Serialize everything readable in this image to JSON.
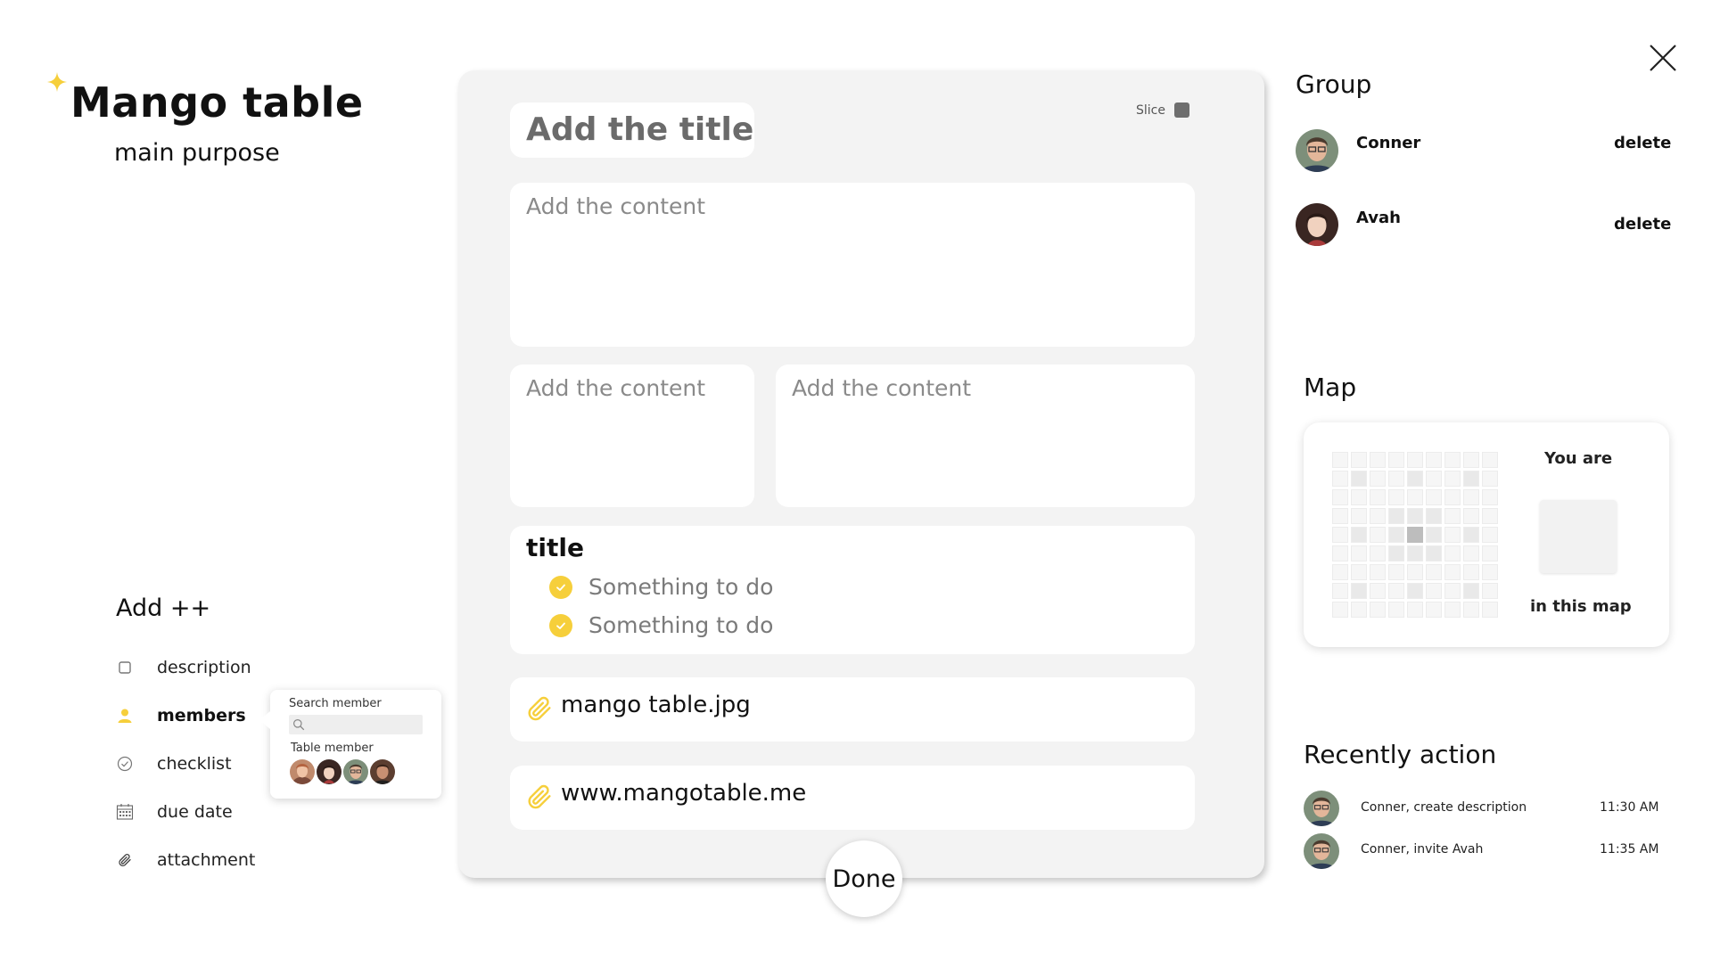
{
  "app": {
    "title": "Mango table",
    "subtitle": "main purpose",
    "accent_color": "#f6cf3b"
  },
  "add_menu": {
    "title": "Add ++",
    "items": [
      {
        "label": "description",
        "icon": "square-icon"
      },
      {
        "label": "members",
        "icon": "person-icon",
        "active": true
      },
      {
        "label": "checklist",
        "icon": "check-circle-icon"
      },
      {
        "label": "due date",
        "icon": "calendar-icon"
      },
      {
        "label": "attachment",
        "icon": "paperclip-icon"
      }
    ]
  },
  "member_popup": {
    "search_label": "Search member",
    "search_value": "",
    "table_member_label": "Table member"
  },
  "card": {
    "title_placeholder": "Add the title",
    "slice_label": "Slice",
    "content_placeholders": [
      "Add the content",
      "Add the content",
      "Add the content"
    ],
    "checklist": {
      "title": "title",
      "items": [
        "Something to do",
        "Something to do"
      ]
    },
    "attachments": [
      "mango table.jpg",
      "www.mangotable.me"
    ],
    "done_label": "Done"
  },
  "group": {
    "title": "Group",
    "members": [
      {
        "name": "Conner",
        "action": "delete"
      },
      {
        "name": "Avah",
        "action": "delete"
      }
    ]
  },
  "map": {
    "title": "Map",
    "you_are": "You are",
    "in_this_map": "in this map"
  },
  "recent": {
    "title": "Recently action",
    "items": [
      {
        "text": "Conner, create description",
        "time": "11:30 AM"
      },
      {
        "text": "Conner, invite Avah",
        "time": "11:35 AM"
      }
    ]
  }
}
